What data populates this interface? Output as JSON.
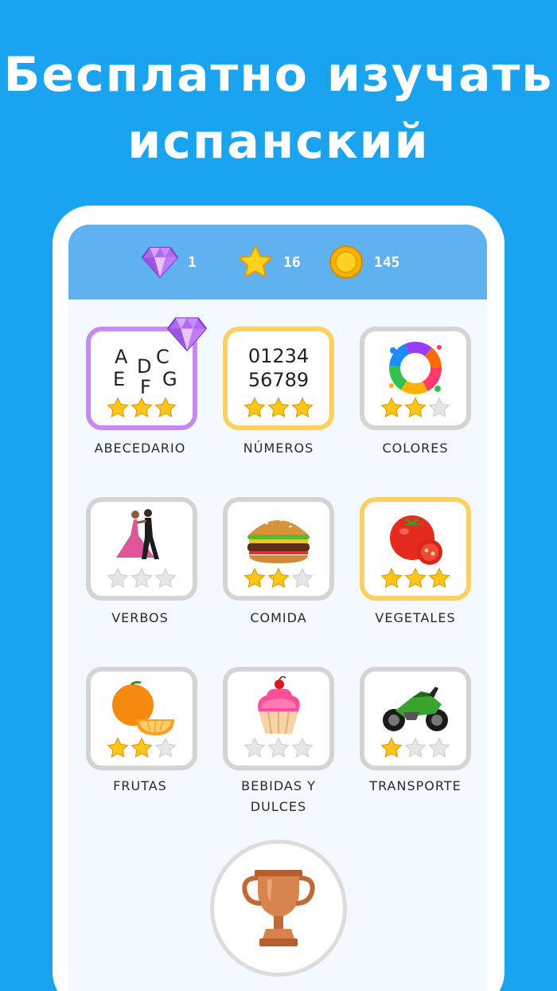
{
  "promo": {
    "line1": "Бесплатно изучать",
    "line2": "испанский"
  },
  "stats": {
    "gems": "1",
    "stars": "16",
    "coins": "145"
  },
  "colors": {
    "background": "#1aa3ee",
    "top_bar": "#5fb1f0",
    "tile_gold_border": "#fcd160",
    "tile_purple_border": "#c58bf0",
    "tile_gray_border": "#d4d4d4"
  },
  "categories": [
    {
      "label": "ABECEDARIO",
      "stars": 3,
      "art": "alphabet-letters",
      "art_text": [
        "A",
        "D",
        "C",
        "E",
        "F",
        "G"
      ],
      "badge": "gem-icon"
    },
    {
      "label": "NÚMEROS",
      "stars": 3,
      "art": "numbers",
      "art_text": [
        "01234",
        "56789"
      ]
    },
    {
      "label": "COLORES",
      "stars": 2,
      "art": "color-splash-icon"
    },
    {
      "label": "VERBOS",
      "stars": 0,
      "art": "dancers-icon"
    },
    {
      "label": "COMIDA",
      "stars": 2,
      "art": "burger-icon"
    },
    {
      "label": "VEGETALES",
      "stars": 3,
      "art": "tomato-icon"
    },
    {
      "label": "FRUTAS",
      "stars": 2,
      "art": "orange-icon"
    },
    {
      "label": "BEBIDAS Y DULCES",
      "label_lines": [
        "BEBIDAS Y",
        "DULCES"
      ],
      "stars": 0,
      "art": "cupcake-icon"
    },
    {
      "label": "TRANSPORTE",
      "stars": 1,
      "art": "motorcycle-icon"
    }
  ],
  "trophy": {
    "icon": "trophy-icon"
  }
}
